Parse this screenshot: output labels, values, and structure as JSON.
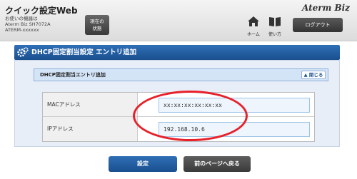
{
  "header": {
    "app_title": "クイック設定Web",
    "device_caption": "お使いの機器は",
    "device_model": "Aterm Biz SH7072A",
    "device_id": "ATERM-xxxxxx",
    "status_button": {
      "line1": "現在の",
      "line2": "状態"
    },
    "home_label": "ホーム",
    "help_label": "使い方",
    "brand": "Aterm Biz",
    "logout_label": "ログアウト"
  },
  "page": {
    "title": "DHCP固定割当設定 エントリ追加"
  },
  "entry": {
    "header": "DHCP固定割当エントリ追加",
    "close_label": "閉じる",
    "fields": [
      {
        "label": "MACアドレス",
        "value": "xx:xx:xx:xx:xx:xx"
      },
      {
        "label": "IPアドレス",
        "value": "192.168.10.6"
      }
    ]
  },
  "buttons": {
    "set": "設定",
    "back": "前のページへ戻る"
  },
  "colors": {
    "accent_blue": "#1a4f8f",
    "highlight_red": "#e8202a"
  }
}
